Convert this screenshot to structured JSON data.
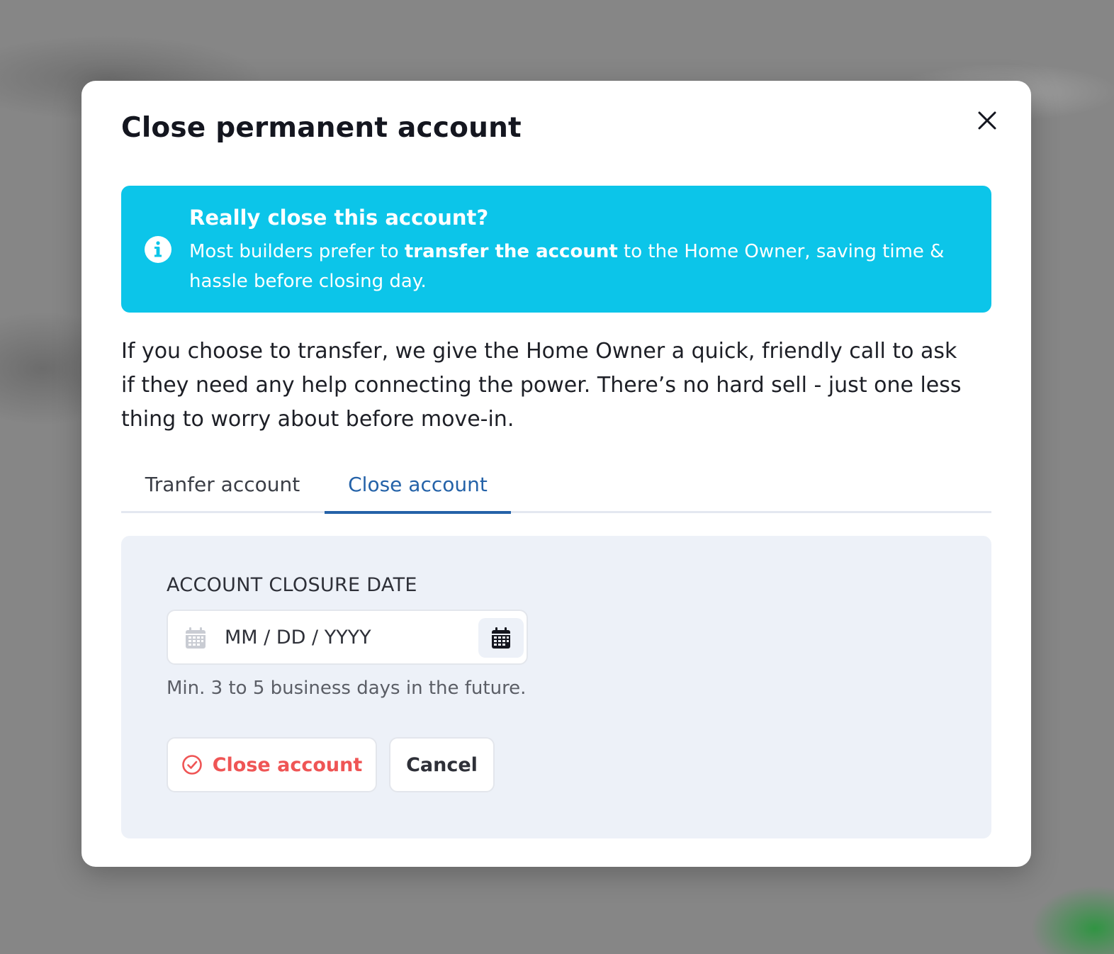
{
  "modal": {
    "title": "Close permanent account",
    "close_icon": "close-icon"
  },
  "alert": {
    "icon": "info-icon",
    "title": "Really close this account?",
    "body_prefix": "Most builders prefer to ",
    "body_bold": "transfer the account",
    "body_suffix": " to the Home Owner, saving time & hassle before closing day.",
    "color": "#0cc5e9"
  },
  "intro": "If you choose to transfer, we give the Home Owner a quick, friendly call to ask if they need any help connecting the power. There’s no hard sell - just one less thing to worry about before move-in.",
  "tabs": [
    {
      "label": "Tranfer account",
      "active": false
    },
    {
      "label": "Close account",
      "active": true
    }
  ],
  "form": {
    "field_label": "ACCOUNT CLOSURE DATE",
    "date_placeholder": "MM / DD / YYYY",
    "date_value": "",
    "hint": "Min. 3 to 5 business days in the future.",
    "close_button_label": "Close account",
    "close_button_icon": "check-circle-icon",
    "cancel_button_label": "Cancel"
  },
  "colors": {
    "accent_blue": "#2462a8",
    "danger_red": "#ef5555",
    "panel_bg": "#edf1f8"
  }
}
